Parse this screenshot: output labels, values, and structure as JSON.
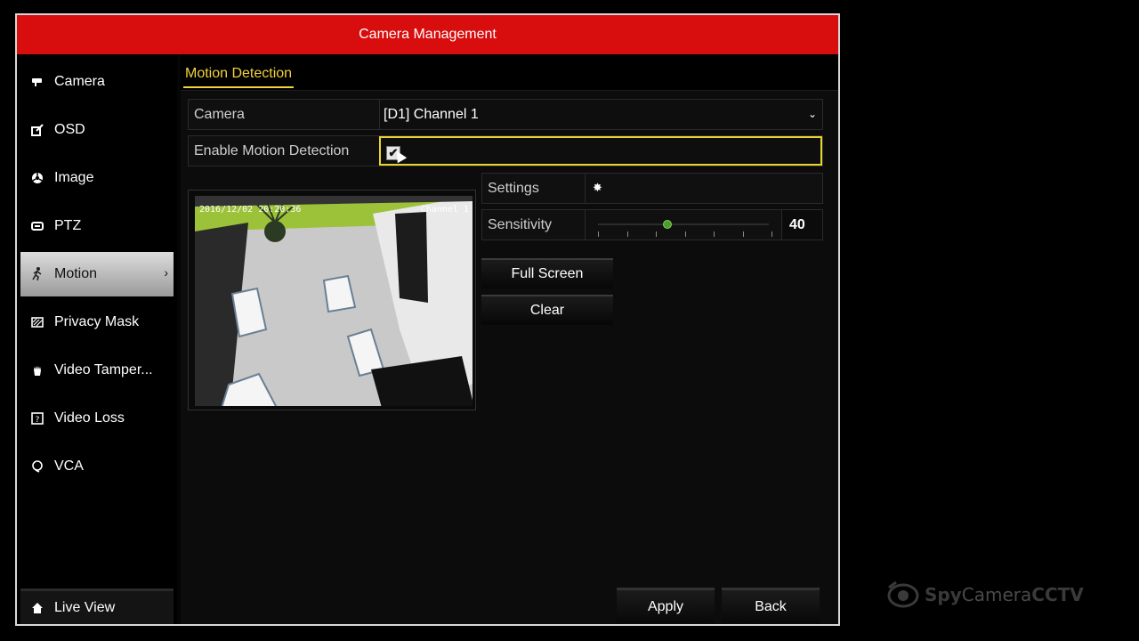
{
  "window": {
    "title": "Camera Management"
  },
  "sidebar": {
    "items": [
      {
        "label": "Camera",
        "icon": "camera-icon"
      },
      {
        "label": "OSD",
        "icon": "osd-icon"
      },
      {
        "label": "Image",
        "icon": "image-icon"
      },
      {
        "label": "PTZ",
        "icon": "ptz-icon"
      },
      {
        "label": "Motion",
        "icon": "motion-icon",
        "active": true
      },
      {
        "label": "Privacy Mask",
        "icon": "privacy-mask-icon"
      },
      {
        "label": "Video Tamper...",
        "icon": "video-tamper-icon"
      },
      {
        "label": "Video Loss",
        "icon": "video-loss-icon"
      },
      {
        "label": "VCA",
        "icon": "vca-icon"
      }
    ],
    "live_view": "Live View"
  },
  "tabs": {
    "active": "Motion Detection"
  },
  "form": {
    "camera_label": "Camera",
    "camera_value": "[D1] Channel 1",
    "enable_label": "Enable Motion Detection",
    "enable_checked": true
  },
  "preview": {
    "timestamp": "2016/12/02 20:20:36",
    "channel_name": "Channel 1"
  },
  "settings": {
    "label": "Settings"
  },
  "sensitivity": {
    "label": "Sensitivity",
    "value": "40",
    "level_percent": 40
  },
  "buttons": {
    "full_screen": "Full Screen",
    "clear": "Clear",
    "apply": "Apply",
    "back": "Back"
  },
  "watermark": {
    "spy": "Spy",
    "camera": "Camera",
    "cctv": "CCTV"
  },
  "colors": {
    "title_bar": "#d80d0d",
    "accent_yellow": "#f1d23c",
    "slider_knob": "#4e9b2e"
  }
}
